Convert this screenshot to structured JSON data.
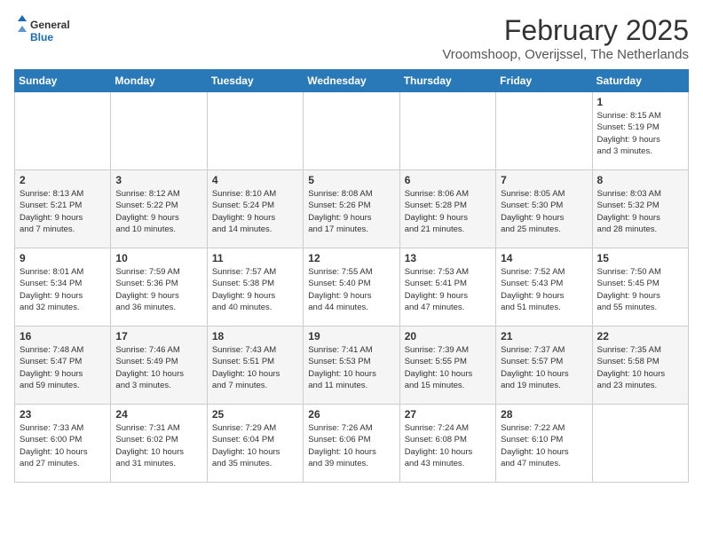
{
  "header": {
    "logo_general": "General",
    "logo_blue": "Blue",
    "title": "February 2025",
    "subtitle": "Vroomshoop, Overijssel, The Netherlands"
  },
  "weekdays": [
    "Sunday",
    "Monday",
    "Tuesday",
    "Wednesday",
    "Thursday",
    "Friday",
    "Saturday"
  ],
  "weeks": [
    [
      {
        "day": "",
        "info": ""
      },
      {
        "day": "",
        "info": ""
      },
      {
        "day": "",
        "info": ""
      },
      {
        "day": "",
        "info": ""
      },
      {
        "day": "",
        "info": ""
      },
      {
        "day": "",
        "info": ""
      },
      {
        "day": "1",
        "info": "Sunrise: 8:15 AM\nSunset: 5:19 PM\nDaylight: 9 hours\nand 3 minutes."
      }
    ],
    [
      {
        "day": "2",
        "info": "Sunrise: 8:13 AM\nSunset: 5:21 PM\nDaylight: 9 hours\nand 7 minutes."
      },
      {
        "day": "3",
        "info": "Sunrise: 8:12 AM\nSunset: 5:22 PM\nDaylight: 9 hours\nand 10 minutes."
      },
      {
        "day": "4",
        "info": "Sunrise: 8:10 AM\nSunset: 5:24 PM\nDaylight: 9 hours\nand 14 minutes."
      },
      {
        "day": "5",
        "info": "Sunrise: 8:08 AM\nSunset: 5:26 PM\nDaylight: 9 hours\nand 17 minutes."
      },
      {
        "day": "6",
        "info": "Sunrise: 8:06 AM\nSunset: 5:28 PM\nDaylight: 9 hours\nand 21 minutes."
      },
      {
        "day": "7",
        "info": "Sunrise: 8:05 AM\nSunset: 5:30 PM\nDaylight: 9 hours\nand 25 minutes."
      },
      {
        "day": "8",
        "info": "Sunrise: 8:03 AM\nSunset: 5:32 PM\nDaylight: 9 hours\nand 28 minutes."
      }
    ],
    [
      {
        "day": "9",
        "info": "Sunrise: 8:01 AM\nSunset: 5:34 PM\nDaylight: 9 hours\nand 32 minutes."
      },
      {
        "day": "10",
        "info": "Sunrise: 7:59 AM\nSunset: 5:36 PM\nDaylight: 9 hours\nand 36 minutes."
      },
      {
        "day": "11",
        "info": "Sunrise: 7:57 AM\nSunset: 5:38 PM\nDaylight: 9 hours\nand 40 minutes."
      },
      {
        "day": "12",
        "info": "Sunrise: 7:55 AM\nSunset: 5:40 PM\nDaylight: 9 hours\nand 44 minutes."
      },
      {
        "day": "13",
        "info": "Sunrise: 7:53 AM\nSunset: 5:41 PM\nDaylight: 9 hours\nand 47 minutes."
      },
      {
        "day": "14",
        "info": "Sunrise: 7:52 AM\nSunset: 5:43 PM\nDaylight: 9 hours\nand 51 minutes."
      },
      {
        "day": "15",
        "info": "Sunrise: 7:50 AM\nSunset: 5:45 PM\nDaylight: 9 hours\nand 55 minutes."
      }
    ],
    [
      {
        "day": "16",
        "info": "Sunrise: 7:48 AM\nSunset: 5:47 PM\nDaylight: 9 hours\nand 59 minutes."
      },
      {
        "day": "17",
        "info": "Sunrise: 7:46 AM\nSunset: 5:49 PM\nDaylight: 10 hours\nand 3 minutes."
      },
      {
        "day": "18",
        "info": "Sunrise: 7:43 AM\nSunset: 5:51 PM\nDaylight: 10 hours\nand 7 minutes."
      },
      {
        "day": "19",
        "info": "Sunrise: 7:41 AM\nSunset: 5:53 PM\nDaylight: 10 hours\nand 11 minutes."
      },
      {
        "day": "20",
        "info": "Sunrise: 7:39 AM\nSunset: 5:55 PM\nDaylight: 10 hours\nand 15 minutes."
      },
      {
        "day": "21",
        "info": "Sunrise: 7:37 AM\nSunset: 5:57 PM\nDaylight: 10 hours\nand 19 minutes."
      },
      {
        "day": "22",
        "info": "Sunrise: 7:35 AM\nSunset: 5:58 PM\nDaylight: 10 hours\nand 23 minutes."
      }
    ],
    [
      {
        "day": "23",
        "info": "Sunrise: 7:33 AM\nSunset: 6:00 PM\nDaylight: 10 hours\nand 27 minutes."
      },
      {
        "day": "24",
        "info": "Sunrise: 7:31 AM\nSunset: 6:02 PM\nDaylight: 10 hours\nand 31 minutes."
      },
      {
        "day": "25",
        "info": "Sunrise: 7:29 AM\nSunset: 6:04 PM\nDaylight: 10 hours\nand 35 minutes."
      },
      {
        "day": "26",
        "info": "Sunrise: 7:26 AM\nSunset: 6:06 PM\nDaylight: 10 hours\nand 39 minutes."
      },
      {
        "day": "27",
        "info": "Sunrise: 7:24 AM\nSunset: 6:08 PM\nDaylight: 10 hours\nand 43 minutes."
      },
      {
        "day": "28",
        "info": "Sunrise: 7:22 AM\nSunset: 6:10 PM\nDaylight: 10 hours\nand 47 minutes."
      },
      {
        "day": "",
        "info": ""
      }
    ]
  ]
}
